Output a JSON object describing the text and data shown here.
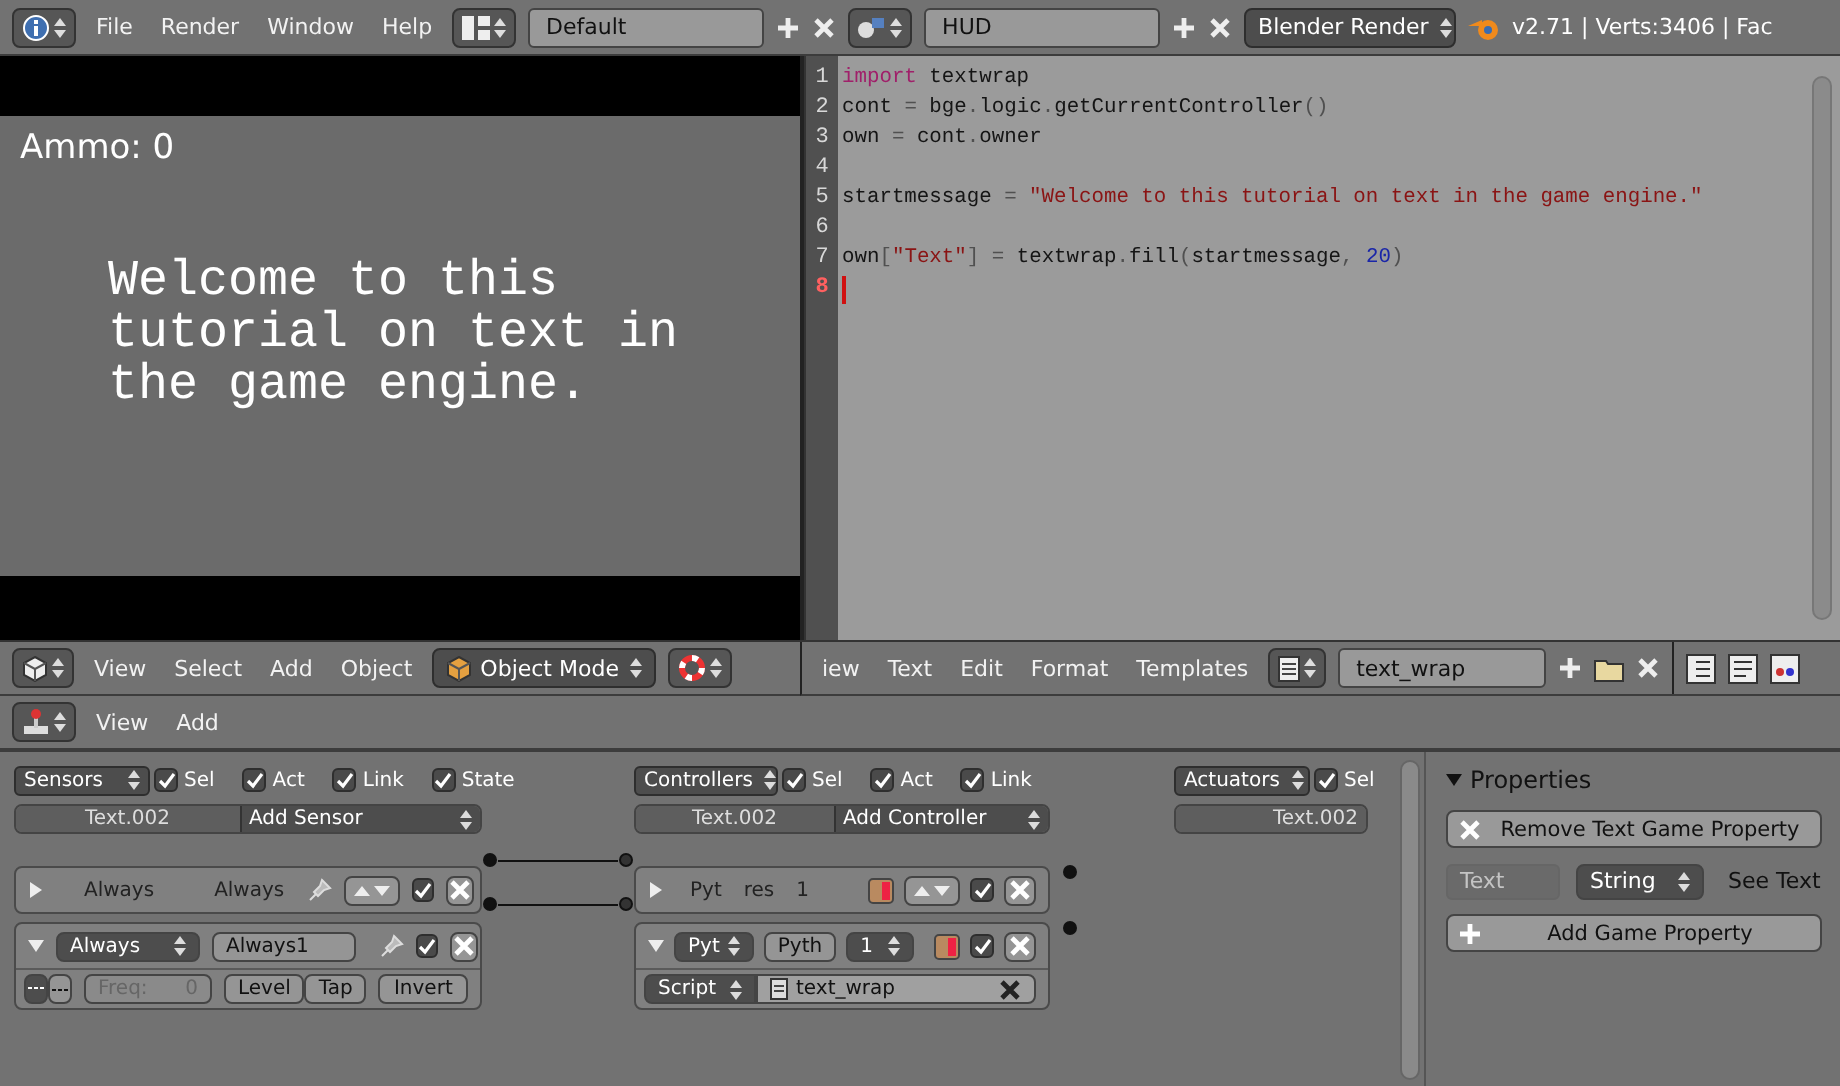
{
  "top_bar": {
    "menus": [
      "File",
      "Render",
      "Window",
      "Help"
    ],
    "screen_layout": "Default",
    "scene": "HUD",
    "engine": "Blender Render",
    "stats": "v2.71 | Verts:3406 | Fac"
  },
  "game_view": {
    "hud_label": "Ammo: 0",
    "text_lines": [
      "Welcome to this",
      "tutorial on text in",
      "the game engine."
    ]
  },
  "text_editor": {
    "lines": [
      {
        "number": "1",
        "current": false,
        "tokens": [
          {
            "kind": "keyword",
            "text": "import"
          },
          {
            "kind": "plain",
            "text": " textwrap"
          }
        ]
      },
      {
        "number": "2",
        "current": false,
        "tokens": [
          {
            "kind": "plain",
            "text": "cont "
          },
          {
            "kind": "punct",
            "text": "="
          },
          {
            "kind": "plain",
            "text": " bge"
          },
          {
            "kind": "punct",
            "text": "."
          },
          {
            "kind": "plain",
            "text": "logic"
          },
          {
            "kind": "punct",
            "text": "."
          },
          {
            "kind": "plain",
            "text": "getCurrentController"
          },
          {
            "kind": "punct",
            "text": "()"
          }
        ]
      },
      {
        "number": "3",
        "current": false,
        "tokens": [
          {
            "kind": "plain",
            "text": "own "
          },
          {
            "kind": "punct",
            "text": "="
          },
          {
            "kind": "plain",
            "text": " cont"
          },
          {
            "kind": "punct",
            "text": "."
          },
          {
            "kind": "plain",
            "text": "owner"
          }
        ]
      },
      {
        "number": "4",
        "current": false
      },
      {
        "number": "5",
        "current": false,
        "tokens": [
          {
            "kind": "plain",
            "text": "startmessage "
          },
          {
            "kind": "punct",
            "text": "= "
          },
          {
            "kind": "string",
            "text": "\"Welcome to this tutorial on text in the game engine.\""
          }
        ]
      },
      {
        "number": "6",
        "current": false
      },
      {
        "number": "7",
        "current": false,
        "tokens": [
          {
            "kind": "plain",
            "text": "own"
          },
          {
            "kind": "punct",
            "text": "["
          },
          {
            "kind": "string",
            "text": "\"Text\""
          },
          {
            "kind": "punct",
            "text": "] ="
          },
          {
            "kind": "plain",
            "text": " textwrap"
          },
          {
            "kind": "punct",
            "text": "."
          },
          {
            "kind": "plain",
            "text": "fill"
          },
          {
            "kind": "punct",
            "text": "("
          },
          {
            "kind": "plain",
            "text": "startmessage"
          },
          {
            "kind": "punct",
            "text": ", "
          },
          {
            "kind": "number",
            "text": "20"
          },
          {
            "kind": "punct",
            "text": ")"
          }
        ]
      },
      {
        "number": "8",
        "current": true
      }
    ]
  },
  "view3d_header": {
    "menus": [
      "View",
      "Select",
      "Add",
      "Object"
    ],
    "mode": "Object Mode"
  },
  "text_header": {
    "menus": [
      "iew",
      "Text",
      "Edit",
      "Format",
      "Templates"
    ],
    "text_name": "text_wrap"
  },
  "logic_header": {
    "menus": [
      "View",
      "Add"
    ]
  },
  "sensors": {
    "type_menu": "Sensors",
    "filters": [
      {
        "label": "Sel",
        "checked": true
      },
      {
        "label": "Act",
        "checked": true
      },
      {
        "label": "Link",
        "checked": true
      },
      {
        "label": "State",
        "checked": true
      }
    ],
    "object": "Text.002",
    "add": "Add Sensor",
    "bricks": [
      {
        "expanded": false,
        "type": "Always",
        "name": "Always",
        "active": true
      },
      {
        "expanded": true,
        "type": "Always",
        "name": "Always1",
        "active": true,
        "freq_label": "Freq:",
        "freq": "0",
        "buttons": [
          "Level",
          "Tap",
          "Invert"
        ]
      }
    ]
  },
  "controllers": {
    "type_menu": "Controllers",
    "filters": [
      {
        "label": "Sel",
        "checked": true
      },
      {
        "label": "Act",
        "checked": true
      },
      {
        "label": "Link",
        "checked": true
      }
    ],
    "object": "Text.002",
    "add": "Add Controller",
    "bricks": [
      {
        "expanded": false,
        "type": "Pyt",
        "name": "res",
        "state": "1",
        "active": true
      },
      {
        "expanded": true,
        "type": "Pyt",
        "name": "Pyth",
        "state": "1",
        "active": true,
        "mode": "Script",
        "script": "text_wrap"
      }
    ]
  },
  "actuators": {
    "type_menu": "Actuators",
    "filters": [
      {
        "label": "Sel",
        "checked": true
      }
    ],
    "object": "Text.002"
  },
  "properties": {
    "title": "Properties",
    "expanded": true,
    "remove_button": "Remove Text Game Property",
    "property": {
      "name": "Text",
      "type": "String",
      "debug_label": "See Text"
    },
    "add_button": "Add Game Property"
  }
}
